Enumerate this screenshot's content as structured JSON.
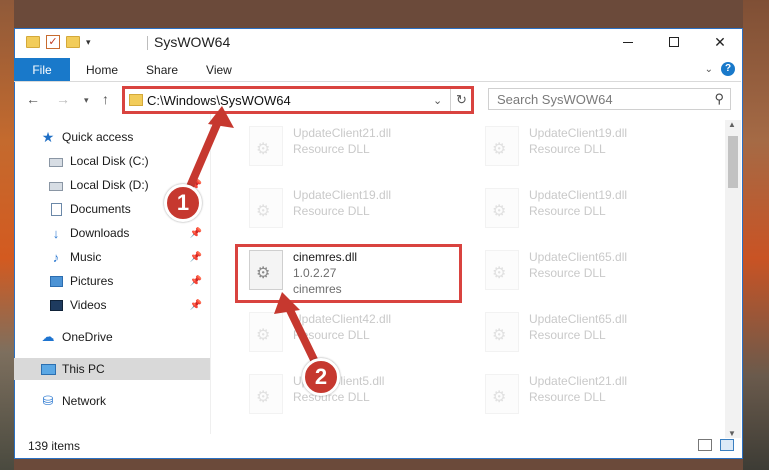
{
  "window": {
    "title": "SysWOW64",
    "minimize_label": "—",
    "maximize_label": "☐",
    "close_label": "✕"
  },
  "ribbon": {
    "file_tab": "File",
    "tabs": [
      "Home",
      "Share",
      "View"
    ]
  },
  "navigation": {
    "address_path": "C:\\Windows\\SysWOW64",
    "search_placeholder": "Search SysWOW64"
  },
  "sidebar": {
    "items": [
      {
        "label": "Quick access",
        "icon": "star-icon"
      },
      {
        "label": "Local Disk (C:)",
        "icon": "drive-icon"
      },
      {
        "label": "Local Disk (D:)",
        "icon": "drive-icon"
      },
      {
        "label": "Documents",
        "icon": "documents-icon"
      },
      {
        "label": "Downloads",
        "icon": "downloads-icon"
      },
      {
        "label": "Music",
        "icon": "music-icon"
      },
      {
        "label": "Pictures",
        "icon": "pictures-icon"
      },
      {
        "label": "Videos",
        "icon": "videos-icon"
      },
      {
        "label": "OneDrive",
        "icon": "cloud-icon"
      },
      {
        "label": "This PC",
        "icon": "pc-icon"
      },
      {
        "label": "Network",
        "icon": "network-icon"
      }
    ]
  },
  "files": [
    {
      "name": "UpdateClient21.dll",
      "sub1": "Resource DLL",
      "sub2": "",
      "faded": true
    },
    {
      "name": "UpdateClient19.dll",
      "sub1": "Resource DLL",
      "sub2": "",
      "faded": true
    },
    {
      "name": "UpdateClient19.dll",
      "sub1": "Resource DLL",
      "sub2": "",
      "faded": true
    },
    {
      "name": "UpdateClient19.dll",
      "sub1": "Resource DLL",
      "sub2": "",
      "faded": true
    },
    {
      "name": "cinemres.dll",
      "sub1": "1.0.2.27",
      "sub2": "cinemres",
      "faded": false
    },
    {
      "name": "UpdateClient65.dll",
      "sub1": "Resource DLL",
      "sub2": "",
      "faded": true
    },
    {
      "name": "UpdateClient42.dll",
      "sub1": "Resource DLL",
      "sub2": "",
      "faded": true
    },
    {
      "name": "UpdateClient65.dll",
      "sub1": "Resource DLL",
      "sub2": "",
      "faded": true
    },
    {
      "name": "UpdateClient5.dll",
      "sub1": "Resource DLL",
      "sub2": "",
      "faded": true
    },
    {
      "name": "UpdateClient21.dll",
      "sub1": "Resource DLL",
      "sub2": "",
      "faded": true
    }
  ],
  "status": {
    "item_count": "139 items"
  },
  "annotations": {
    "step1": "1",
    "step2": "2",
    "color": "#c6382f"
  }
}
